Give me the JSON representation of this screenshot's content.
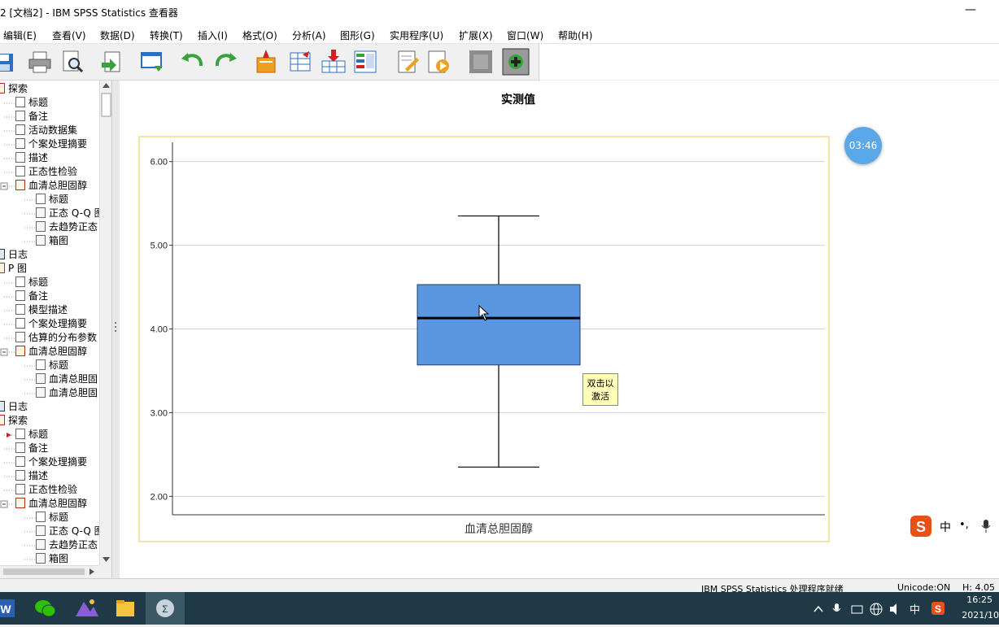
{
  "window": {
    "title": "2 [文档2] - IBM SPSS Statistics 查看器",
    "minimize": "—"
  },
  "menu": [
    "编辑(E)",
    "查看(V)",
    "数据(D)",
    "转换(T)",
    "插入(I)",
    "格式(O)",
    "分析(A)",
    "图形(G)",
    "实用程序(U)",
    "扩展(X)",
    "窗口(W)",
    "帮助(H)"
  ],
  "toolbar": {
    "icons": [
      "save-icon",
      "print-icon",
      "print-preview-icon",
      "export-icon",
      "recall-dialog-icon",
      "undo-icon",
      "redo-icon",
      "goto-data-icon",
      "goto-case-icon",
      "insert-variable-icon",
      "variables-icon",
      "edit-output-icon",
      "run-script-icon",
      "hide-icon",
      "designate-window-icon"
    ]
  },
  "outline": {
    "items": [
      {
        "label": "探索",
        "icon": "book"
      },
      {
        "label": "标题",
        "icon": "title"
      },
      {
        "label": "备注",
        "icon": "table"
      },
      {
        "label": "活动数据集",
        "icon": "table"
      },
      {
        "label": "个案处理摘要",
        "icon": "table"
      },
      {
        "label": "描述",
        "icon": "table"
      },
      {
        "label": "正态性检验",
        "icon": "table"
      },
      {
        "label": "血清总胆固醇",
        "icon": "book"
      },
      {
        "label": "标题",
        "icon": "title"
      },
      {
        "label": "正态 Q-Q 图",
        "icon": "chart"
      },
      {
        "label": "去趋势正态",
        "icon": "chart"
      },
      {
        "label": "箱图",
        "icon": "chart"
      },
      {
        "label": "日志",
        "icon": "log"
      },
      {
        "label": "P 图",
        "icon": "book"
      },
      {
        "label": "标题",
        "icon": "title"
      },
      {
        "label": "备注",
        "icon": "table"
      },
      {
        "label": "模型描述",
        "icon": "table"
      },
      {
        "label": "个案处理摘要",
        "icon": "table"
      },
      {
        "label": "估算的分布参数",
        "icon": "table"
      },
      {
        "label": "血清总胆固醇",
        "icon": "book"
      },
      {
        "label": "标题",
        "icon": "title"
      },
      {
        "label": "血清总胆固",
        "icon": "chart"
      },
      {
        "label": "血清总胆固",
        "icon": "chart"
      },
      {
        "label": "日志",
        "icon": "log"
      },
      {
        "label": "探索",
        "icon": "book"
      },
      {
        "label": "标题",
        "icon": "title"
      },
      {
        "label": "备注",
        "icon": "table"
      },
      {
        "label": "个案处理摘要",
        "icon": "table"
      },
      {
        "label": "描述",
        "icon": "table"
      },
      {
        "label": "正态性检验",
        "icon": "table"
      },
      {
        "label": "血清总胆固醇",
        "icon": "book"
      },
      {
        "label": "标题",
        "icon": "title"
      },
      {
        "label": "正态 Q-Q 图",
        "icon": "chart"
      },
      {
        "label": "去趋势正态",
        "icon": "chart"
      },
      {
        "label": "箱图",
        "icon": "chart"
      }
    ]
  },
  "content": {
    "title": "实测值",
    "tooltip_line1": "双击以",
    "tooltip_line2": "激活",
    "timer": "03:46"
  },
  "chart_data": {
    "type": "box",
    "categories": [
      "血清总胆固醇"
    ],
    "xlabel": "血清总胆固醇",
    "ylabel": "",
    "ylim": [
      1.78,
      6.23
    ],
    "yticks": [
      "2.00",
      "3.00",
      "4.00",
      "5.00",
      "6.00"
    ],
    "grid": true,
    "box": {
      "min": 2.35,
      "q1": 3.57,
      "median": 4.13,
      "q3": 4.53,
      "max": 5.35
    },
    "colors": {
      "box": "#5b96e0",
      "grid": "#d0d0d0",
      "frame": "#f3e3a5"
    }
  },
  "ime": {
    "label1": "中",
    "label2": "•,",
    "logo": "S"
  },
  "statusbar": {
    "status": "IBM SPSS Statistics 处理程序就绪",
    "unicode": "Unicode:ON",
    "height": "H: 4.05"
  },
  "taskbar": {
    "apps": [
      "word-icon",
      "wechat-icon",
      "photos-icon",
      "file-explorer-icon",
      "spss-icon"
    ],
    "tray": {
      "ime": "中",
      "time": "16:25",
      "date": "2021/10"
    }
  }
}
